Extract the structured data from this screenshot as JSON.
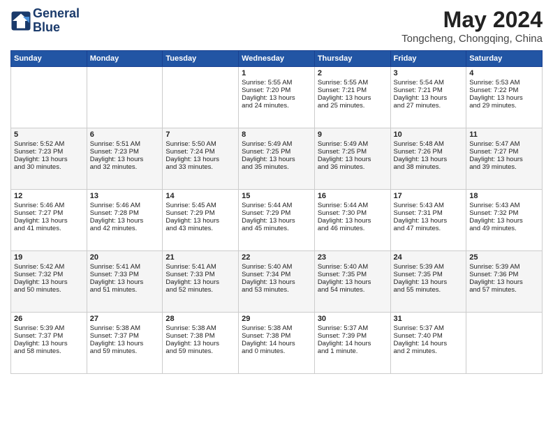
{
  "header": {
    "logo_line1": "General",
    "logo_line2": "Blue",
    "month_year": "May 2024",
    "location": "Tongcheng, Chongqing, China"
  },
  "days_of_week": [
    "Sunday",
    "Monday",
    "Tuesday",
    "Wednesday",
    "Thursday",
    "Friday",
    "Saturday"
  ],
  "weeks": [
    [
      {
        "day": "",
        "info": ""
      },
      {
        "day": "",
        "info": ""
      },
      {
        "day": "",
        "info": ""
      },
      {
        "day": "1",
        "info": "Sunrise: 5:55 AM\nSunset: 7:20 PM\nDaylight: 13 hours\nand 24 minutes."
      },
      {
        "day": "2",
        "info": "Sunrise: 5:55 AM\nSunset: 7:21 PM\nDaylight: 13 hours\nand 25 minutes."
      },
      {
        "day": "3",
        "info": "Sunrise: 5:54 AM\nSunset: 7:21 PM\nDaylight: 13 hours\nand 27 minutes."
      },
      {
        "day": "4",
        "info": "Sunrise: 5:53 AM\nSunset: 7:22 PM\nDaylight: 13 hours\nand 29 minutes."
      }
    ],
    [
      {
        "day": "5",
        "info": "Sunrise: 5:52 AM\nSunset: 7:23 PM\nDaylight: 13 hours\nand 30 minutes."
      },
      {
        "day": "6",
        "info": "Sunrise: 5:51 AM\nSunset: 7:23 PM\nDaylight: 13 hours\nand 32 minutes."
      },
      {
        "day": "7",
        "info": "Sunrise: 5:50 AM\nSunset: 7:24 PM\nDaylight: 13 hours\nand 33 minutes."
      },
      {
        "day": "8",
        "info": "Sunrise: 5:49 AM\nSunset: 7:25 PM\nDaylight: 13 hours\nand 35 minutes."
      },
      {
        "day": "9",
        "info": "Sunrise: 5:49 AM\nSunset: 7:25 PM\nDaylight: 13 hours\nand 36 minutes."
      },
      {
        "day": "10",
        "info": "Sunrise: 5:48 AM\nSunset: 7:26 PM\nDaylight: 13 hours\nand 38 minutes."
      },
      {
        "day": "11",
        "info": "Sunrise: 5:47 AM\nSunset: 7:27 PM\nDaylight: 13 hours\nand 39 minutes."
      }
    ],
    [
      {
        "day": "12",
        "info": "Sunrise: 5:46 AM\nSunset: 7:27 PM\nDaylight: 13 hours\nand 41 minutes."
      },
      {
        "day": "13",
        "info": "Sunrise: 5:46 AM\nSunset: 7:28 PM\nDaylight: 13 hours\nand 42 minutes."
      },
      {
        "day": "14",
        "info": "Sunrise: 5:45 AM\nSunset: 7:29 PM\nDaylight: 13 hours\nand 43 minutes."
      },
      {
        "day": "15",
        "info": "Sunrise: 5:44 AM\nSunset: 7:29 PM\nDaylight: 13 hours\nand 45 minutes."
      },
      {
        "day": "16",
        "info": "Sunrise: 5:44 AM\nSunset: 7:30 PM\nDaylight: 13 hours\nand 46 minutes."
      },
      {
        "day": "17",
        "info": "Sunrise: 5:43 AM\nSunset: 7:31 PM\nDaylight: 13 hours\nand 47 minutes."
      },
      {
        "day": "18",
        "info": "Sunrise: 5:43 AM\nSunset: 7:32 PM\nDaylight: 13 hours\nand 49 minutes."
      }
    ],
    [
      {
        "day": "19",
        "info": "Sunrise: 5:42 AM\nSunset: 7:32 PM\nDaylight: 13 hours\nand 50 minutes."
      },
      {
        "day": "20",
        "info": "Sunrise: 5:41 AM\nSunset: 7:33 PM\nDaylight: 13 hours\nand 51 minutes."
      },
      {
        "day": "21",
        "info": "Sunrise: 5:41 AM\nSunset: 7:33 PM\nDaylight: 13 hours\nand 52 minutes."
      },
      {
        "day": "22",
        "info": "Sunrise: 5:40 AM\nSunset: 7:34 PM\nDaylight: 13 hours\nand 53 minutes."
      },
      {
        "day": "23",
        "info": "Sunrise: 5:40 AM\nSunset: 7:35 PM\nDaylight: 13 hours\nand 54 minutes."
      },
      {
        "day": "24",
        "info": "Sunrise: 5:39 AM\nSunset: 7:35 PM\nDaylight: 13 hours\nand 55 minutes."
      },
      {
        "day": "25",
        "info": "Sunrise: 5:39 AM\nSunset: 7:36 PM\nDaylight: 13 hours\nand 57 minutes."
      }
    ],
    [
      {
        "day": "26",
        "info": "Sunrise: 5:39 AM\nSunset: 7:37 PM\nDaylight: 13 hours\nand 58 minutes."
      },
      {
        "day": "27",
        "info": "Sunrise: 5:38 AM\nSunset: 7:37 PM\nDaylight: 13 hours\nand 59 minutes."
      },
      {
        "day": "28",
        "info": "Sunrise: 5:38 AM\nSunset: 7:38 PM\nDaylight: 13 hours\nand 59 minutes."
      },
      {
        "day": "29",
        "info": "Sunrise: 5:38 AM\nSunset: 7:38 PM\nDaylight: 14 hours\nand 0 minutes."
      },
      {
        "day": "30",
        "info": "Sunrise: 5:37 AM\nSunset: 7:39 PM\nDaylight: 14 hours\nand 1 minute."
      },
      {
        "day": "31",
        "info": "Sunrise: 5:37 AM\nSunset: 7:40 PM\nDaylight: 14 hours\nand 2 minutes."
      },
      {
        "day": "",
        "info": ""
      }
    ]
  ]
}
